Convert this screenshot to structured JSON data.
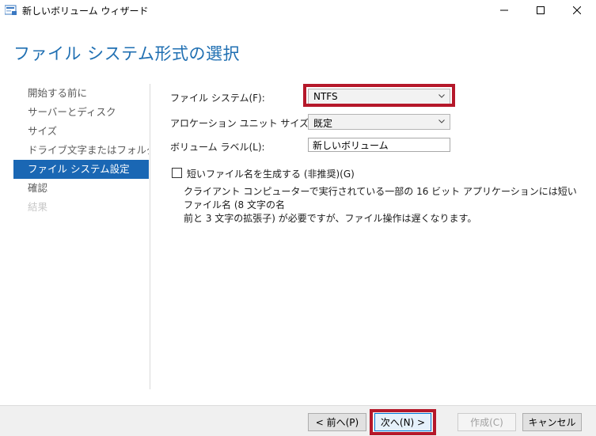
{
  "window": {
    "title": "新しいボリューム ウィザード",
    "minimize_icon": "minimize-icon",
    "maximize_icon": "maximize-icon",
    "close_icon": "close-icon"
  },
  "page": {
    "heading": "ファイル システム形式の選択"
  },
  "sidebar": {
    "items": [
      {
        "label": "開始する前に",
        "state": "normal"
      },
      {
        "label": "サーバーとディスク",
        "state": "normal"
      },
      {
        "label": "サイズ",
        "state": "normal"
      },
      {
        "label": "ドライブ文字またはフォルダー",
        "state": "normal"
      },
      {
        "label": "ファイル システム設定",
        "state": "active"
      },
      {
        "label": "確認",
        "state": "normal"
      },
      {
        "label": "結果",
        "state": "disabled"
      }
    ]
  },
  "form": {
    "file_system": {
      "label": "ファイル システム(F):",
      "value": "NTFS"
    },
    "allocation_unit": {
      "label": "アロケーション ユニット サイズ(A):",
      "value": "既定"
    },
    "volume_label": {
      "label": "ボリューム ラベル(L):",
      "value": "新しいボリューム"
    },
    "short_names": {
      "label": "短いファイル名を生成する (非推奨)(G)",
      "checked": false,
      "description_line1": "クライアント コンピューターで実行されている一部の 16 ビット アプリケーションには短いファイル名 (8 文字の名",
      "description_line2": "前と 3 文字の拡張子) が必要ですが、ファイル操作は遅くなります。"
    }
  },
  "buttons": {
    "back": "< 前へ(P)",
    "next": "次へ(N) >",
    "create": "作成(C)",
    "cancel": "キャンセル"
  },
  "colors": {
    "accent": "#1a67b4",
    "heading": "#1f6fb2",
    "highlight": "#b5182a"
  }
}
